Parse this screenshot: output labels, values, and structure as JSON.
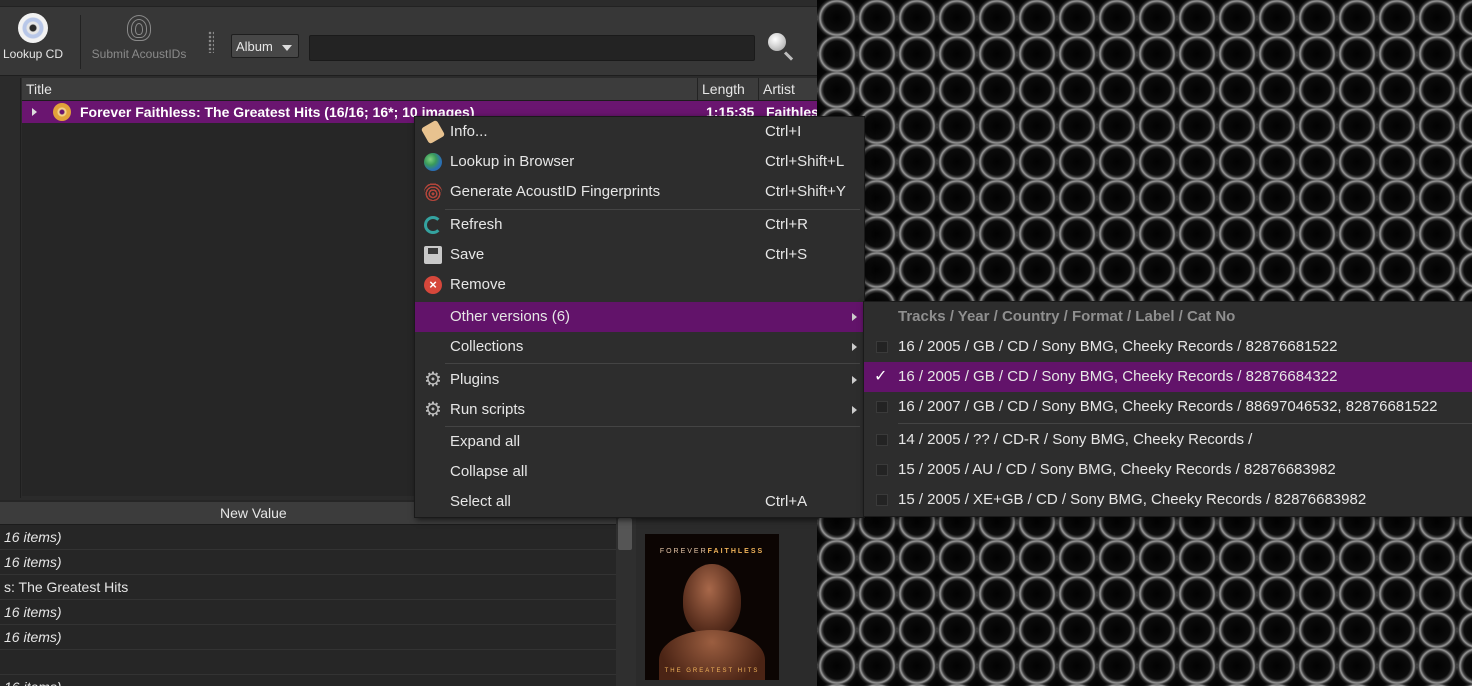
{
  "toolbar": {
    "lookup_cd": "Lookup CD",
    "submit_acoustids": "Submit AcoustIDs",
    "search_type": "Album",
    "search_value": ""
  },
  "tree": {
    "columns": [
      "Title",
      "Length",
      "Artist"
    ],
    "album": {
      "title": "Forever Faithless: The Greatest Hits (16/16; 16*; 10 images)",
      "length": "1:15:35",
      "artist": "Faithles"
    }
  },
  "metadata": {
    "header": "New Value",
    "rows": [
      {
        "text": "16 items)",
        "italic": true
      },
      {
        "text": "16 items)",
        "italic": true
      },
      {
        "text": "s: The Greatest Hits",
        "italic": false
      },
      {
        "text": "16 items)",
        "italic": true
      },
      {
        "text": "16 items)",
        "italic": true
      },
      {
        "text": "",
        "italic": false
      },
      {
        "text": "16 items)",
        "italic": true
      }
    ]
  },
  "cover": {
    "brand_a": "FOREVER",
    "brand_b": "FAITHLESS",
    "subtitle": "THE GREATEST HITS"
  },
  "context_menu": {
    "items": [
      {
        "label": "Info...",
        "shortcut": "Ctrl+I",
        "icon": "tag-icon"
      },
      {
        "label": "Lookup in Browser",
        "shortcut": "Ctrl+Shift+L",
        "icon": "globe-icon"
      },
      {
        "label": "Generate AcoustID Fingerprints",
        "shortcut": "Ctrl+Shift+Y",
        "icon": "fingerprint-icon"
      },
      {
        "label": "Refresh",
        "shortcut": "Ctrl+R",
        "icon": "refresh-icon"
      },
      {
        "label": "Save",
        "shortcut": "Ctrl+S",
        "icon": "save-icon"
      },
      {
        "label": "Remove",
        "shortcut": "",
        "icon": "remove-icon"
      },
      {
        "label": "Other versions (6)",
        "shortcut": "",
        "icon": ""
      },
      {
        "label": "Collections",
        "shortcut": "",
        "icon": ""
      },
      {
        "label": "Plugins",
        "shortcut": "",
        "icon": "gear-icon"
      },
      {
        "label": "Run scripts",
        "shortcut": "",
        "icon": "gear-icon"
      },
      {
        "label": "Expand all",
        "shortcut": "",
        "icon": ""
      },
      {
        "label": "Collapse all",
        "shortcut": "",
        "icon": ""
      },
      {
        "label": "Select all",
        "shortcut": "Ctrl+A",
        "icon": ""
      }
    ]
  },
  "versions_menu": {
    "header": "Tracks / Year / Country / Format / Label / Cat No",
    "items": [
      {
        "label": "16 / 2005 / GB / CD / Sony BMG, Cheeky Records / 82876681522",
        "checked": false
      },
      {
        "label": "16 / 2005 / GB / CD / Sony BMG, Cheeky Records / 82876684322",
        "checked": true
      },
      {
        "label": "16 / 2007 / GB / CD / Sony BMG, Cheeky Records / 88697046532, 82876681522",
        "checked": false
      },
      {
        "label": "14 / 2005 / ?? / CD-R / Sony BMG, Cheeky Records /",
        "checked": false
      },
      {
        "label": "15 / 2005 / AU / CD / Sony BMG, Cheeky Records / 82876683982",
        "checked": false
      },
      {
        "label": "15 / 2005 / XE+GB / CD / Sony BMG, Cheeky Records / 82876683982",
        "checked": false
      }
    ]
  },
  "colors": {
    "highlight": "#62136a",
    "album_row": "#6a1570"
  }
}
